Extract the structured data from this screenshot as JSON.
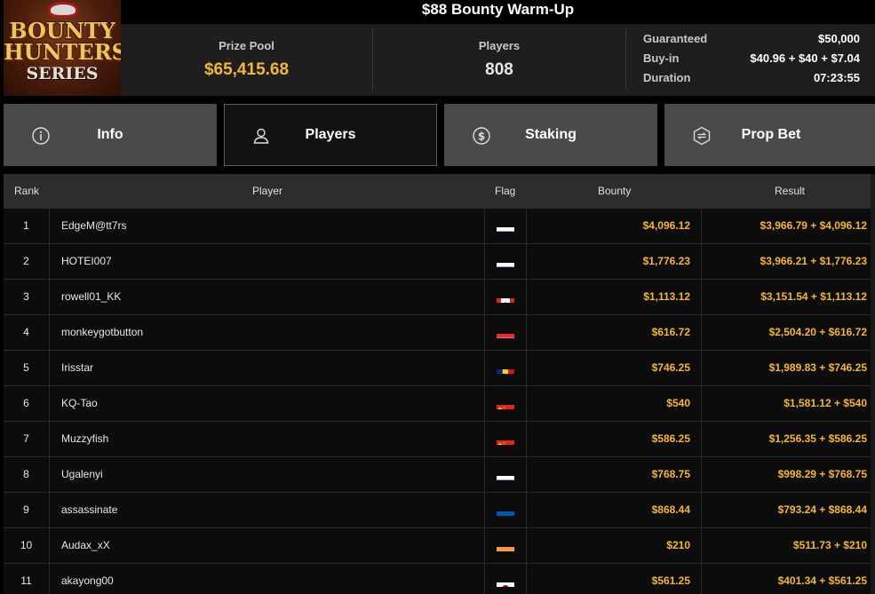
{
  "logo": {
    "line1": "BOUNTY",
    "line2": "HUNTERS",
    "line3": "SERIES"
  },
  "title": "$88 Bounty Warm-Up",
  "stats": {
    "prize_pool_label": "Prize Pool",
    "prize_pool_value": "$65,415.68",
    "players_label": "Players",
    "players_value": "808",
    "details": [
      {
        "label": "Guaranteed",
        "value": "$50,000"
      },
      {
        "label": "Buy-in",
        "value": "$40.96 + $40 + $7.04"
      },
      {
        "label": "Duration",
        "value": "07:23:55"
      }
    ]
  },
  "tabs": [
    {
      "label": "Info",
      "icon": "info-icon",
      "active": false
    },
    {
      "label": "Players",
      "icon": "user-icon",
      "active": true
    },
    {
      "label": "Staking",
      "icon": "dollar-coin-icon",
      "active": false
    },
    {
      "label": "Prop Bet",
      "icon": "prop-bet-icon",
      "active": false
    }
  ],
  "table": {
    "headers": {
      "rank": "Rank",
      "player": "Player",
      "flag": "Flag",
      "bounty": "Bounty",
      "result": "Result"
    },
    "rows": [
      {
        "rank": "1",
        "player": "EdgeM@tt7rs",
        "flag": "russia",
        "bounty": "$4,096.12",
        "result": "$3,966.79 + $4,096.12"
      },
      {
        "rank": "2",
        "player": "HOTEI007",
        "flag": "russia",
        "bounty": "$1,776.23",
        "result": "$3,966.21 + $1,776.23"
      },
      {
        "rank": "3",
        "player": "rowell01_KK",
        "flag": "canada",
        "bounty": "$1,113.12",
        "result": "$3,151.54 + $1,113.12"
      },
      {
        "rank": "4",
        "player": "monkeygotbutton",
        "flag": "luxembourg",
        "bounty": "$616.72",
        "result": "$2,504.20 + $616.72"
      },
      {
        "rank": "5",
        "player": "Irisstar",
        "flag": "romania",
        "bounty": "$746.25",
        "result": "$1,989.83 + $746.25"
      },
      {
        "rank": "6",
        "player": "KQ-Tao",
        "flag": "china",
        "bounty": "$540",
        "result": "$1,581.12 + $540"
      },
      {
        "rank": "7",
        "player": "Muzzyfish",
        "flag": "china",
        "bounty": "$586.25",
        "result": "$1,256.35 + $586.25"
      },
      {
        "rank": "8",
        "player": "Ugalenyi",
        "flag": "russia",
        "bounty": "$768.75",
        "result": "$998.29 + $768.75"
      },
      {
        "rank": "9",
        "player": "assassinate",
        "flag": "ukraine",
        "bounty": "$868.44",
        "result": "$793.24 + $868.44"
      },
      {
        "rank": "10",
        "player": "Audax_xX",
        "flag": "india",
        "bounty": "$210",
        "result": "$511.73 + $210"
      },
      {
        "rank": "11",
        "player": "akayong00",
        "flag": "japan",
        "bounty": "$561.25",
        "result": "$401.34 + $561.25"
      }
    ]
  },
  "colors": {
    "gold": "#f5b731",
    "tab_bg": "#4a4a4a",
    "tab_active_bg": "#121212",
    "header_bg": "#2c2c2c"
  }
}
